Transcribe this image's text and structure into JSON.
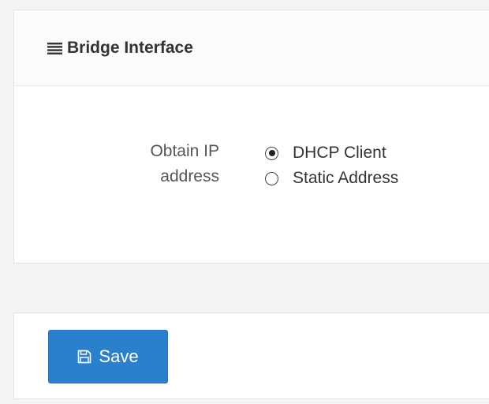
{
  "panel": {
    "title": "Bridge Interface",
    "title_icon": "menu-icon"
  },
  "form": {
    "obtain_ip_label": "Obtain IP address",
    "options": [
      {
        "label": "DHCP Client",
        "selected": true
      },
      {
        "label": "Static Address",
        "selected": false
      }
    ]
  },
  "footer": {
    "save_label": "Save",
    "save_icon": "floppy-disk-icon",
    "save_color": "#2a80cc"
  }
}
